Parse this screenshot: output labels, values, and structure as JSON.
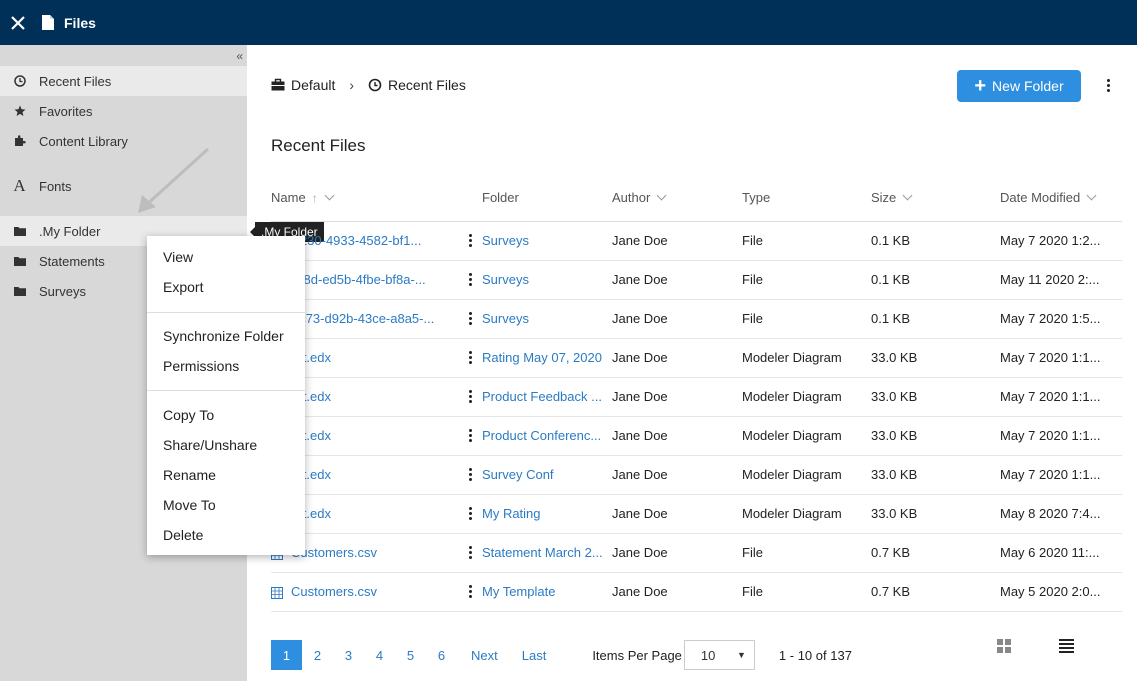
{
  "header": {
    "title": "Files"
  },
  "sidebar": {
    "items": [
      {
        "label": "Recent Files",
        "icon": "clock-icon"
      },
      {
        "label": "Favorites",
        "icon": "star-icon"
      },
      {
        "label": "Content Library",
        "icon": "puzzle-icon"
      },
      {
        "label": "Fonts",
        "icon": "font-icon"
      },
      {
        "label": ".My Folder",
        "icon": "folder-icon"
      },
      {
        "label": "Statements",
        "icon": "folder-icon"
      },
      {
        "label": "Surveys",
        "icon": "folder-icon"
      }
    ],
    "tooltip": ".My Folder"
  },
  "context_menu": {
    "items": [
      "View",
      "Export",
      "Synchronize Folder",
      "Permissions",
      "Copy To",
      "Share/Unshare",
      "Rename",
      "Move To",
      "Delete"
    ]
  },
  "breadcrumb": {
    "root": "Default",
    "current": "Recent Files"
  },
  "toolbar": {
    "new_folder": "New Folder"
  },
  "section_title": "Recent Files",
  "table": {
    "columns": [
      "Name",
      "Folder",
      "Author",
      "Type",
      "Size",
      "Date Modified"
    ],
    "rows": [
      {
        "name": "1e26230-4933-4582-bf1...",
        "folder": "Surveys",
        "author": "Jane Doe",
        "type": "File",
        "size": "0.1 KB",
        "date": "May 7 2020 1:2..."
      },
      {
        "name": "b545f8d-ed5b-4fbe-bf8a-...",
        "folder": "Surveys",
        "author": "Jane Doe",
        "type": "File",
        "size": "0.1 KB",
        "date": "May 11 2020 2:..."
      },
      {
        "name": "2acac73-d92b-43ce-a8a5-...",
        "folder": "Surveys",
        "author": "Jane Doe",
        "type": "File",
        "size": "0.1 KB",
        "date": "May 7 2020 1:5..."
      },
      {
        "name": "ontact.edx",
        "folder": "Rating May 07, 2020",
        "author": "Jane Doe",
        "type": "Modeler Diagram",
        "size": "33.0 KB",
        "date": "May 7 2020 1:1..."
      },
      {
        "name": "ontact.edx",
        "folder": "Product Feedback ...",
        "author": "Jane Doe",
        "type": "Modeler Diagram",
        "size": "33.0 KB",
        "date": "May 7 2020 1:1..."
      },
      {
        "name": "ontact.edx",
        "folder": "Product Conferenc...",
        "author": "Jane Doe",
        "type": "Modeler Diagram",
        "size": "33.0 KB",
        "date": "May 7 2020 1:1..."
      },
      {
        "name": "ontact.edx",
        "folder": "Survey Conf",
        "author": "Jane Doe",
        "type": "Modeler Diagram",
        "size": "33.0 KB",
        "date": "May 7 2020 1:1..."
      },
      {
        "name": "ontact.edx",
        "folder": "My Rating",
        "author": "Jane Doe",
        "type": "Modeler Diagram",
        "size": "33.0 KB",
        "date": "May 8 2020 7:4..."
      },
      {
        "name": "Customers.csv",
        "folder": "Statement March 2...",
        "author": "Jane Doe",
        "type": "File",
        "size": "0.7 KB",
        "date": "May 6 2020 11:..."
      },
      {
        "name": "Customers.csv",
        "folder": "My Template",
        "author": "Jane Doe",
        "type": "File",
        "size": "0.7 KB",
        "date": "May 5 2020 2:0..."
      }
    ]
  },
  "pagination": {
    "pages": [
      "1",
      "2",
      "3",
      "4",
      "5",
      "6"
    ],
    "current": "1",
    "next": "Next",
    "last": "Last",
    "items_per_page_label": "Items Per Page",
    "items_per_page_value": "10",
    "range": "1 - 10 of 137"
  },
  "colors": {
    "header": "#003057",
    "accent": "#2e8fe0",
    "link": "#2b7bc4",
    "sidebar": "#d8d8d8"
  }
}
